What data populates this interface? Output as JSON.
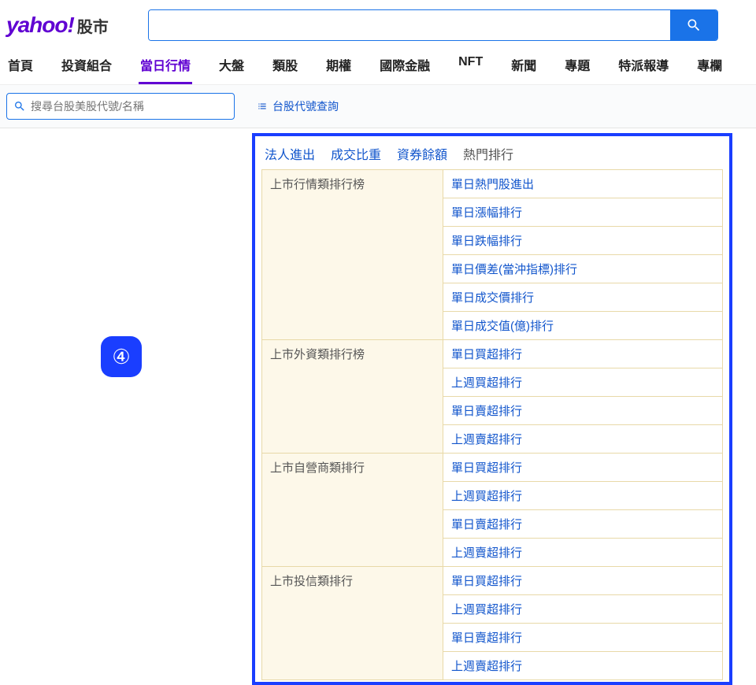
{
  "logo": {
    "main": "yahoo!",
    "sub": "股市"
  },
  "nav": [
    "首頁",
    "投資組合",
    "當日行情",
    "大盤",
    "類股",
    "期權",
    "國際金融",
    "NFT",
    "新聞",
    "專題",
    "特派報導",
    "專欄"
  ],
  "nav_active_index": 2,
  "stock_search_placeholder": "搜尋台股美股代號/名稱",
  "code_lookup_label": "台股代號查詢",
  "tabs": [
    "法人進出",
    "成交比重",
    "資券餘額",
    "熱門排行"
  ],
  "tab_current_index": 3,
  "badge": "④",
  "groups": [
    {
      "header": "上市行情類排行榜",
      "links": [
        "單日熱門股進出",
        "單日漲幅排行",
        "單日跌幅排行",
        "單日價差(當沖指標)排行",
        "單日成交價排行",
        "單日成交值(億)排行"
      ]
    },
    {
      "header": "上市外資類排行榜",
      "links": [
        "單日買超排行",
        "上週買超排行",
        "單日賣超排行",
        "上週賣超排行"
      ]
    },
    {
      "header": "上市自營商類排行",
      "links": [
        "單日買超排行",
        "上週買超排行",
        "單日賣超排行",
        "上週賣超排行"
      ]
    },
    {
      "header": "上市投信類排行",
      "links": [
        "單日買超排行",
        "上週買超排行",
        "單日賣超排行",
        "上週賣超排行"
      ]
    }
  ]
}
